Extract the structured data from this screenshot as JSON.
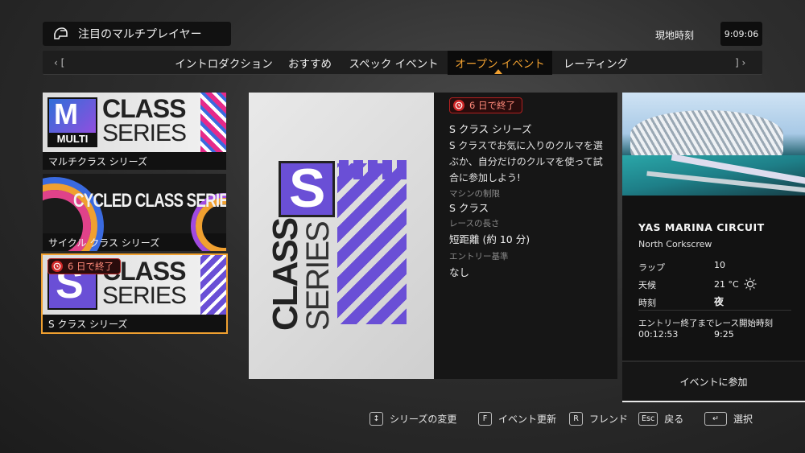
{
  "header": {
    "title": "注目のマルチプレイヤー",
    "clock_label": "現地時刻",
    "clock_value": "9:09:06"
  },
  "tabs": {
    "left_arrow": "‹ [",
    "right_arrow": "] ›",
    "items": [
      {
        "label": "イントロダクション"
      },
      {
        "label": "おすすめ"
      },
      {
        "label": "スペック イベント"
      },
      {
        "label": "オープン イベント"
      },
      {
        "label": "レーティング"
      }
    ],
    "active_index": 3
  },
  "series_list": [
    {
      "label": "マルチクラス シリーズ",
      "art_top": "M",
      "art_sub": "MULTI",
      "art_text1": "CLASS",
      "art_text2": "SERIES"
    },
    {
      "label": "サイクル クラス シリーズ",
      "art_text1": "CYCLED CLASS SERIES"
    },
    {
      "label": "S クラス シリーズ",
      "art_top": "S",
      "art_text1": "CLASS",
      "art_text2": "SERIES",
      "badge": "6 日で終了",
      "selected": true
    }
  ],
  "detail": {
    "hero_letter": "S",
    "hero_text1": "CLASS",
    "hero_text2": "SERIES",
    "badge": "6 日で終了",
    "title": "S クラス シリーズ",
    "description": "S クラスでお気に入りのクルマを選ぶか、自分だけのクルマを使って試合に参加しよう!",
    "car_restriction_label": "マシンの制限",
    "car_restriction_value": "S クラス",
    "race_length_label": "レースの長さ",
    "race_length_value": "短距離 (約 10 分)",
    "entry_label": "エントリー基準",
    "entry_value": "なし"
  },
  "track": {
    "circuit": "YAS MARINA CIRCUIT",
    "layout": "North Corkscrew",
    "laps_label": "ラップ",
    "laps_value": "10",
    "weather_label": "天候",
    "weather_value": "21 °C",
    "weather_icon": "sun-icon",
    "time_label": "時刻",
    "time_value": "夜",
    "entry_close_label": "エントリー終了まで",
    "entry_close_value": "00:12:53",
    "race_start_label": "レース開始時刻",
    "race_start_value": "9:25",
    "join_label": "イベントに参加"
  },
  "footer": [
    {
      "key": "↕",
      "label": "シリーズの変更"
    },
    {
      "key": "F",
      "label": "イベント更新"
    },
    {
      "key": "R",
      "label": "フレンド"
    },
    {
      "key": "Esc",
      "label": "戻る"
    },
    {
      "key": "↵",
      "label": "選択"
    }
  ],
  "colors": {
    "accent": "#f0a030",
    "purple": "#6a4fd6",
    "alert": "#d02828"
  }
}
